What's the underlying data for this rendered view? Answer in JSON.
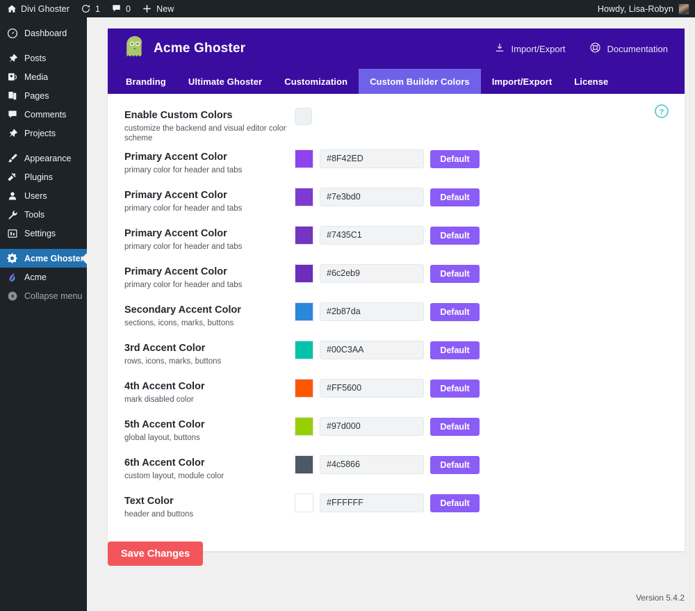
{
  "adminbar": {
    "site_name": "Divi Ghoster",
    "updates_count": "1",
    "comments_count": "0",
    "new_label": "New",
    "howdy": "Howdy, Lisa-Robyn"
  },
  "sidebar": {
    "items": [
      {
        "label": "Dashboard",
        "icon": "dashboard-icon",
        "state": "normal",
        "group": 0
      },
      {
        "label": "Posts",
        "icon": "pin-icon",
        "state": "normal",
        "group": 1
      },
      {
        "label": "Media",
        "icon": "media-icon",
        "state": "normal",
        "group": 1
      },
      {
        "label": "Pages",
        "icon": "pages-icon",
        "state": "normal",
        "group": 1
      },
      {
        "label": "Comments",
        "icon": "comment-icon",
        "state": "normal",
        "group": 1
      },
      {
        "label": "Projects",
        "icon": "pin-icon",
        "state": "normal",
        "group": 1
      },
      {
        "label": "Appearance",
        "icon": "brush-icon",
        "state": "normal",
        "group": 2
      },
      {
        "label": "Plugins",
        "icon": "plug-icon",
        "state": "normal",
        "group": 2
      },
      {
        "label": "Users",
        "icon": "user-icon",
        "state": "normal",
        "group": 2
      },
      {
        "label": "Tools",
        "icon": "wrench-icon",
        "state": "normal",
        "group": 2
      },
      {
        "label": "Settings",
        "icon": "settings-icon",
        "state": "normal",
        "group": 2
      },
      {
        "label": "Acme Ghoster",
        "icon": "gear-icon",
        "state": "active",
        "group": 3
      },
      {
        "label": "Acme",
        "icon": "acme-icon",
        "state": "normal",
        "group": 3
      },
      {
        "label": "Collapse menu",
        "icon": "collapse-icon",
        "state": "dim",
        "group": 3
      }
    ]
  },
  "plugin_header": {
    "title": "Acme Ghoster",
    "logo_icon": "ghost-icon",
    "links": [
      {
        "label": "Import/Export",
        "icon": "download-icon"
      },
      {
        "label": "Documentation",
        "icon": "lifebuoy-icon"
      }
    ]
  },
  "tabs": [
    {
      "label": "Branding",
      "active": false
    },
    {
      "label": "Ultimate Ghoster",
      "active": false
    },
    {
      "label": "Customization",
      "active": false
    },
    {
      "label": "Custom Builder Colors",
      "active": true
    },
    {
      "label": "Import/Export",
      "active": false
    },
    {
      "label": "License",
      "active": false
    }
  ],
  "help_icon": "help-circle-icon",
  "settings": {
    "toggle_row": {
      "title": "Enable Custom Colors",
      "desc": "customize the backend and visual editor color scheme",
      "checked": false
    },
    "default_button_label": "Default",
    "color_rows": [
      {
        "title": "Primary Accent Color",
        "desc": "primary color for header and tabs",
        "value": "#8F42ED",
        "swatch": "#8F42ED"
      },
      {
        "title": "Primary Accent Color",
        "desc": "primary color for header and tabs",
        "value": "#7e3bd0",
        "swatch": "#7e3bd0"
      },
      {
        "title": "Primary Accent Color",
        "desc": "primary color for header and tabs",
        "value": "#7435C1",
        "swatch": "#7435C1"
      },
      {
        "title": "Primary Accent Color",
        "desc": "primary color for header and tabs",
        "value": "#6c2eb9",
        "swatch": "#6c2eb9"
      },
      {
        "title": "Secondary Accent Color",
        "desc": "sections, icons, marks, buttons",
        "value": "#2b87da",
        "swatch": "#2b87da"
      },
      {
        "title": "3rd Accent Color",
        "desc": "rows, icons, marks, buttons",
        "value": "#00C3AA",
        "swatch": "#00C3AA"
      },
      {
        "title": "4th Accent Color",
        "desc": "mark disabled color",
        "value": "#FF5600",
        "swatch": "#FF5600"
      },
      {
        "title": "5th Accent Color",
        "desc": "global layout, buttons",
        "value": "#97d000",
        "swatch": "#97d000"
      },
      {
        "title": "6th Accent Color",
        "desc": "custom layout, module color",
        "value": "#4c5866",
        "swatch": "#4c5866"
      },
      {
        "title": "Text Color",
        "desc": "header and buttons",
        "value": "#FFFFFF",
        "swatch": "#FFFFFF"
      }
    ]
  },
  "save_label": "Save Changes",
  "version": "Version 5.4.2",
  "colors": {
    "header_purple": "#3b0ca0",
    "active_tab": "#6f62e8",
    "save_red": "#f2565b",
    "admin_blue": "#2271b1",
    "help_teal": "#3fc1c9"
  }
}
